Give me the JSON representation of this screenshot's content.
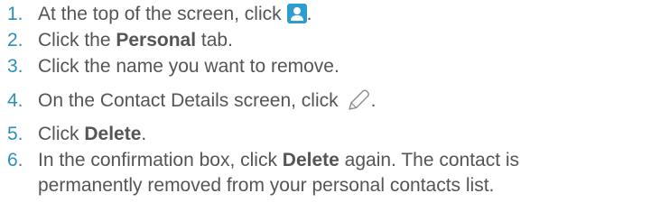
{
  "steps": [
    {
      "num": "1.",
      "before": "At the top of the screen, click",
      "icon": "contacts-person-icon",
      "after": "."
    },
    {
      "num": "2.",
      "before": "Click the ",
      "bold": "Personal",
      "after": " tab."
    },
    {
      "num": "3.",
      "text": "Click the name you want to remove."
    },
    {
      "num": "4.",
      "before": "On the Contact Details screen, click",
      "icon": "edit-pencil-icon",
      "after": "."
    },
    {
      "num": "5.",
      "before": "Click ",
      "bold": "Delete",
      "after": "."
    },
    {
      "num": "6.",
      "before": "In the confirmation box, click ",
      "bold": "Delete",
      "after": " again. The contact is",
      "line2": "permanently removed from your personal contacts list."
    }
  ],
  "colors": {
    "number": "#2d8fb9",
    "text": "#555555",
    "icon_bg": "#2d9ccf"
  }
}
